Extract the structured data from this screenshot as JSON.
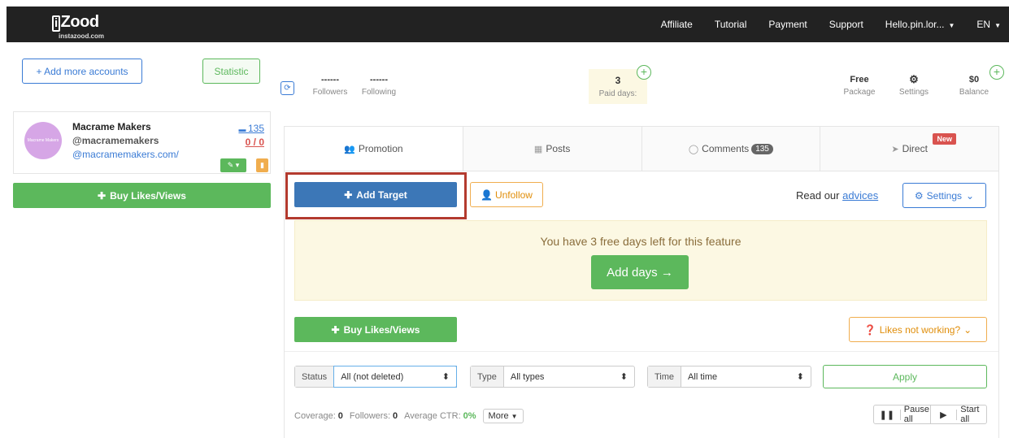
{
  "brand": {
    "logo_text": "Zood",
    "logo_mark": "i",
    "url": "instazood.com"
  },
  "topnav": {
    "affiliate": "Affiliate",
    "tutorial": "Tutorial",
    "payment": "Payment",
    "support": "Support",
    "user": "Hello.pin.lor...",
    "lang": "EN"
  },
  "left": {
    "add_accounts": "+ Add more accounts",
    "statistic": "Statistic",
    "buy_likes": "Buy Likes/Views"
  },
  "account": {
    "avatar_text": "Macrame Makers",
    "name": "Macrame Makers",
    "handle": "@macramemakers",
    "url": "@macramemakers.com/",
    "messages": "135",
    "ratio": "0 / 0"
  },
  "stats": {
    "followers_value": "------",
    "followers_label": "Followers",
    "following_value": "------",
    "following_label": "Following",
    "paid_value": "3",
    "paid_label": "Paid days:",
    "package_value": "Free",
    "package_label": "Package",
    "settings_label": "Settings",
    "balance_value": "$0",
    "balance_label": "Balance"
  },
  "tabs": [
    {
      "label": "Promotion",
      "icon": "users-icon"
    },
    {
      "label": "Posts",
      "icon": "grid-icon"
    },
    {
      "label": "Comments",
      "icon": "comment-icon",
      "badge": "135"
    },
    {
      "label": "Direct",
      "icon": "send-icon",
      "badge": "New"
    }
  ],
  "actions": {
    "add_target": "Add Target",
    "unfollow": "Unfollow",
    "read_our": "Read our",
    "advices": "advices",
    "settings": "Settings"
  },
  "notice": {
    "message": "You have 3 free days left for this feature",
    "add_days": "Add days →"
  },
  "promo": {
    "buy_likes": "Buy Likes/Views",
    "likes_not_working": "Likes not working?"
  },
  "filters": {
    "status_label": "Status",
    "status_value": "All (not deleted)",
    "type_label": "Type",
    "type_value": "All types",
    "time_label": "Time",
    "time_value": "All time",
    "apply": "Apply"
  },
  "metrics": {
    "coverage_label": "Coverage:",
    "coverage_value": "0",
    "followers_label": "Followers:",
    "followers_value": "0",
    "ctr_label": "Average CTR:",
    "ctr_value": "0%",
    "more": "More",
    "pause_all": "Pause all",
    "start_all": "Start all"
  },
  "colors": {
    "topbar": "#222222",
    "primary": "#3c77b7",
    "success": "#5cb85c",
    "warning": "#f0ad4e",
    "danger": "#d9534f",
    "highlight": "#b33a2e"
  }
}
